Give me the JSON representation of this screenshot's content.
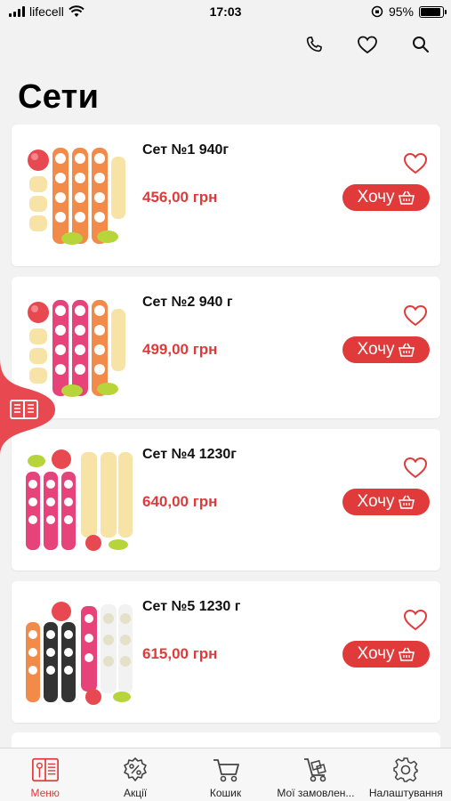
{
  "status_bar": {
    "carrier": "lifecell",
    "time": "17:03",
    "battery": "95%"
  },
  "header": {
    "icons": [
      "phone-icon",
      "heart-icon",
      "search-icon"
    ]
  },
  "page": {
    "title": "Сети"
  },
  "products": [
    {
      "name": "Сет №1 940г",
      "price": "456,00 грн",
      "button": "Хочу"
    },
    {
      "name": "Сет №2 940 г",
      "price": "499,00 грн",
      "button": "Хочу"
    },
    {
      "name": "Сет №4 1230г",
      "price": "640,00 грн",
      "button": "Хочу"
    },
    {
      "name": "Сет №5 1230 г",
      "price": "615,00 грн",
      "button": "Хочу"
    }
  ],
  "tabbar": {
    "items": [
      {
        "label": "Меню",
        "icon": "menu-book-icon",
        "active": true
      },
      {
        "label": "Акції",
        "icon": "discount-icon",
        "active": false
      },
      {
        "label": "Кошик",
        "icon": "cart-icon",
        "active": false
      },
      {
        "label": "Мої замовлен...",
        "icon": "orders-icon",
        "active": false
      },
      {
        "label": "Налаштування",
        "icon": "settings-icon",
        "active": false
      }
    ]
  },
  "colors": {
    "accent": "#e03a3a",
    "background": "#f2f2f2",
    "card": "#ffffff"
  }
}
